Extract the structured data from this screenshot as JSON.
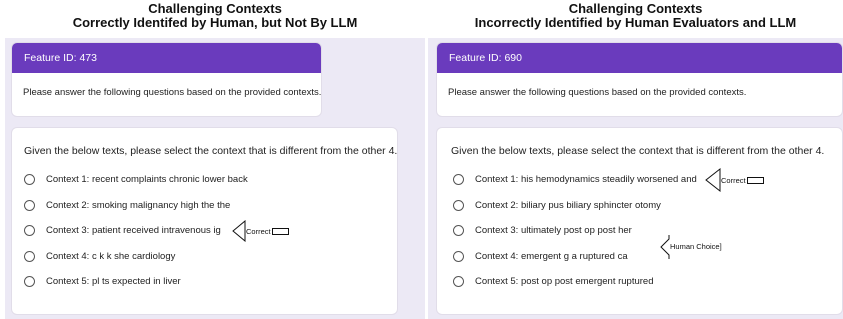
{
  "left": {
    "title_line1": "Challenging Contexts",
    "title_line2": "Correctly Identifed by Human, but Not By LLM",
    "feature_id": "Feature ID: 473",
    "instructions": "Please answer the following questions based on the provided contexts.",
    "question": "Given the below texts, please select the context that is different from the other 4.",
    "options": [
      "Context 1: recent complaints chronic lower back",
      "Context 2: smoking malignancy high the the",
      "Context 3: patient received intravenous ig",
      "Context 4: c k k she cardiology",
      "Context 5: pl ts expected in liver"
    ],
    "annotation": "Correct"
  },
  "right": {
    "title_line1": "Challenging Contexts",
    "title_line2": "Incorrectly Identified by Human Evaluators and LLM",
    "feature_id": "Feature ID: 690",
    "instructions": "Please answer the following questions based on the provided contexts.",
    "question": "Given the below texts, please select the context that is different from the other 4.",
    "options": [
      "Context 1: his hemodynamics steadily worsened and",
      "Context 2: biliary pus biliary sphincter otomy",
      "Context 3: ultimately post op post her",
      "Context 4: emergent g a ruptured ca",
      "Context 5: post op post emergent ruptured"
    ],
    "annotation_correct": "Correct",
    "annotation_human": "Human Choice]"
  },
  "colors": {
    "header_bar": "#6a3bbd",
    "form_background": "#ece9f5"
  }
}
